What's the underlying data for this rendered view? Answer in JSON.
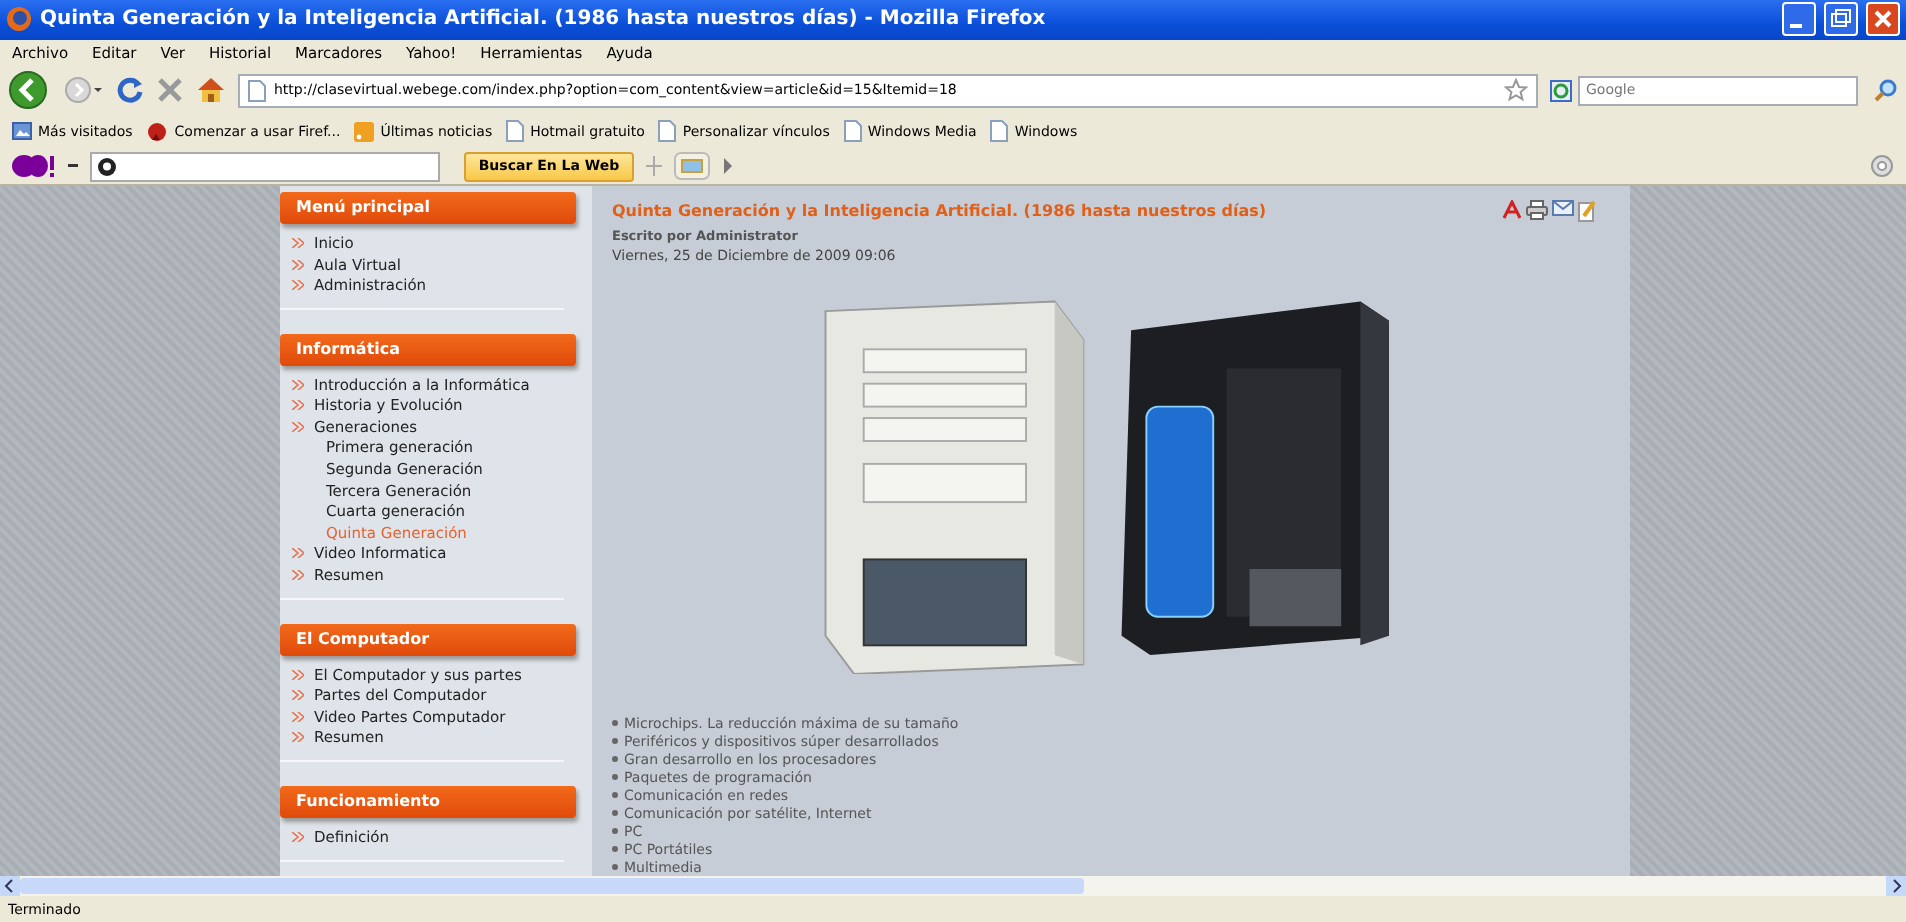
{
  "window": {
    "title": "Quinta Generación y la Inteligencia Artificial. (1986 hasta nuestros días) - Mozilla Firefox"
  },
  "menu_bar": [
    "Archivo",
    "Editar",
    "Ver",
    "Historial",
    "Marcadores",
    "Yahoo!",
    "Herramientas",
    "Ayuda"
  ],
  "nav_bar": {
    "url": "http://clasevirtual.webege.com/index.php?option=com_content&view=article&id=15&Itemid=18",
    "search": {
      "placeholder": "Google"
    }
  },
  "bookmarks": [
    {
      "label": "Más visitados",
      "kind": "folder"
    },
    {
      "label": "Comenzar a usar Firef...",
      "kind": "firefox"
    },
    {
      "label": "Últimas noticias",
      "kind": "feed"
    },
    {
      "label": "Hotmail gratuito",
      "kind": "page"
    },
    {
      "label": "Personalizar vínculos",
      "kind": "page"
    },
    {
      "label": "Windows Media",
      "kind": "page"
    },
    {
      "label": "Windows",
      "kind": "page"
    }
  ],
  "yahoo_bar": {
    "search_button": "Buscar En La Web"
  },
  "sidebar": [
    {
      "title": "Menú principal",
      "items": [
        {
          "label": "Inicio",
          "selected": false
        },
        {
          "label": "Aula Virtual",
          "selected": false
        },
        {
          "label": "Administración",
          "selected": false
        }
      ]
    },
    {
      "title": "Informática",
      "items": [
        {
          "label": "Introducción a la Informática",
          "selected": false
        },
        {
          "label": "Historia y Evolución",
          "selected": false
        },
        {
          "label": "Generaciones",
          "selected": false,
          "children": [
            {
              "label": "Primera generación",
              "selected": false
            },
            {
              "label": "Segunda Generación",
              "selected": false
            },
            {
              "label": "Tercera Generación",
              "selected": false
            },
            {
              "label": "Cuarta generación",
              "selected": false
            },
            {
              "label": "Quinta Generación",
              "selected": true
            }
          ]
        },
        {
          "label": "Video Informatica",
          "selected": false
        },
        {
          "label": "Resumen",
          "selected": false
        }
      ]
    },
    {
      "title": "El Computador",
      "items": [
        {
          "label": "El Computador y sus partes",
          "selected": false
        },
        {
          "label": "Partes del Computador",
          "selected": false
        },
        {
          "label": "Video Partes Computador",
          "selected": false
        },
        {
          "label": "Resumen",
          "selected": false
        }
      ]
    },
    {
      "title": "Funcionamiento",
      "items": [
        {
          "label": "Definición",
          "selected": false
        }
      ]
    }
  ],
  "article": {
    "title": "Quinta Generación y la Inteligencia Artificial. (1986 hasta nuestros días)",
    "author": "Escrito por Administrator",
    "date": "Viernes, 25 de Diciembre de 2009 09:06",
    "bullets": [
      "Microchips. La reducción máxima de su tamaño",
      "Periféricos  y dispositivos súper desarrollados",
      "Gran desarrollo en los procesadores",
      "Paquetes de programación",
      "Comunicación en redes",
      "Comunicación por satélite,  Internet",
      "PC",
      "PC Portátiles",
      "Multimedia"
    ]
  },
  "status_bar": {
    "text": "Terminado"
  }
}
